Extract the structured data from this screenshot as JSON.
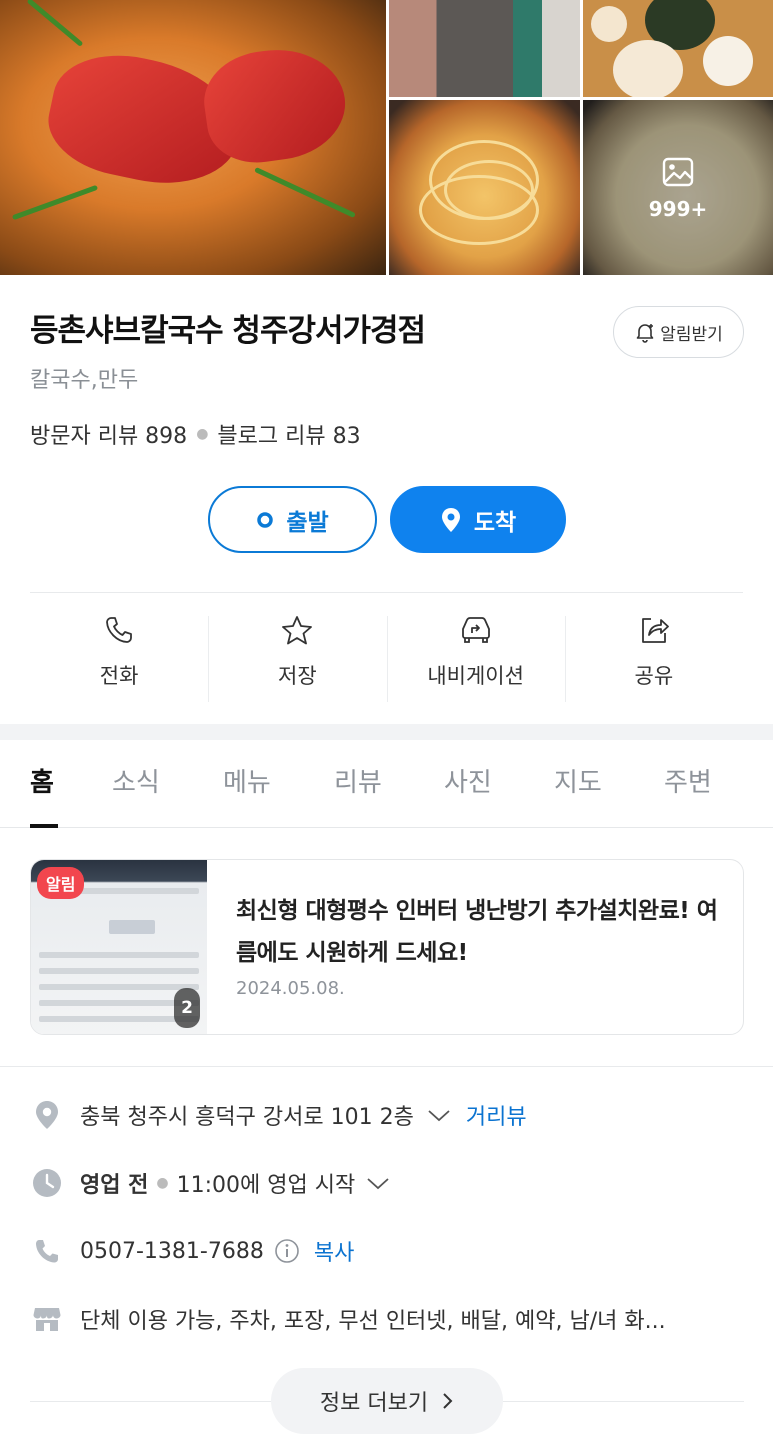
{
  "gallery": {
    "more_count": "999+"
  },
  "place": {
    "name": "등촌샤브칼국수 청주강서가경점",
    "category": "칼국수,만두",
    "visitor_review": "방문자 리뷰 898",
    "blog_review": "블로그 리뷰 83",
    "alarm_label": "알림받기"
  },
  "route": {
    "depart_label": "출발",
    "arrive_label": "도착"
  },
  "actions": [
    {
      "label": "전화",
      "icon": "phone-icon"
    },
    {
      "label": "저장",
      "icon": "star-icon"
    },
    {
      "label": "내비게이션",
      "icon": "car-navigation-icon"
    },
    {
      "label": "공유",
      "icon": "share-icon"
    }
  ],
  "tabs": [
    "홈",
    "소식",
    "메뉴",
    "리뷰",
    "사진",
    "지도",
    "주변"
  ],
  "active_tab": "홈",
  "notice": {
    "badge": "알림",
    "image_count": "2",
    "title": "최신형 대형평수 인버터 냉난방기 추가설치완료! 여름에도 시원하게 드세요!",
    "date": "2024.05.08."
  },
  "info": {
    "address": "충북 청주시 흥덕구 강서로 101 2층",
    "street_view_label": "거리뷰",
    "hours_status": "영업 전",
    "hours_detail": "11:00에 영업 시작",
    "phone": "0507-1381-7688",
    "copy_label": "복사",
    "amenities": "단체 이용 가능, 주차, 포장, 무선 인터넷, 배달, 예약, 남/녀 화..."
  },
  "more_info_label": "정보 더보기",
  "colors": {
    "accent": "#0f82ee",
    "link": "#0b73d0",
    "notice_badge": "#f2464e"
  }
}
